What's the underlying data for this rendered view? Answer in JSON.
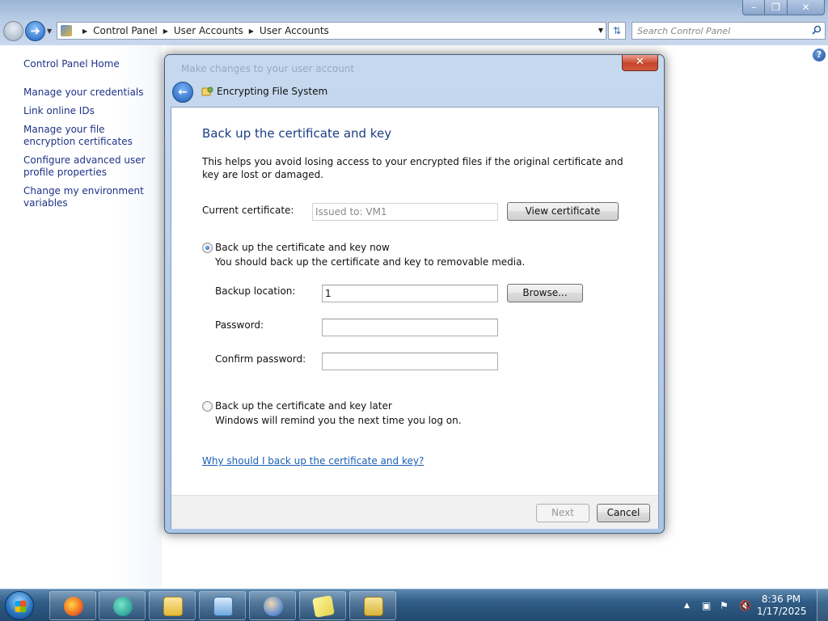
{
  "explorer": {
    "breadcrumb": [
      "Control Panel",
      "User Accounts",
      "User Accounts"
    ],
    "search_placeholder": "Search Control Panel"
  },
  "sidebar": {
    "home": "Control Panel Home",
    "items": [
      "Manage your credentials",
      "Link online IDs",
      "Manage your file encryption certificates",
      "Configure advanced user profile properties",
      "Change my environment variables"
    ]
  },
  "dialog": {
    "background_title": "Make changes to your user account",
    "title": "Encrypting File System",
    "heading": "Back up the certificate and key",
    "intro": "This helps you avoid losing access to your encrypted files if the original certificate and key are lost or damaged.",
    "current_certificate_label": "Current certificate:",
    "current_certificate_value": "Issued to: VM1",
    "view_certificate_button": "View certificate",
    "option_now": {
      "label": "Back up the certificate and key now",
      "description": "You should back up the certificate and key to removable media.",
      "selected": true
    },
    "backup_location_label": "Backup location:",
    "backup_location_value": "1",
    "browse_button": "Browse...",
    "password_label": "Password:",
    "confirm_password_label": "Confirm password:",
    "option_later": {
      "label": "Back up the certificate and key later",
      "description": "Windows will remind you the next time you log on.",
      "selected": false
    },
    "why_link": "Why should I back up the certificate and key?",
    "next_button": "Next",
    "cancel_button": "Cancel"
  },
  "taskbar": {
    "time": "8:36 PM",
    "date": "1/17/2025"
  },
  "colors": {
    "link": "#1e3287",
    "heading": "#1b3d84",
    "hyperlink": "#1a5fb4"
  }
}
